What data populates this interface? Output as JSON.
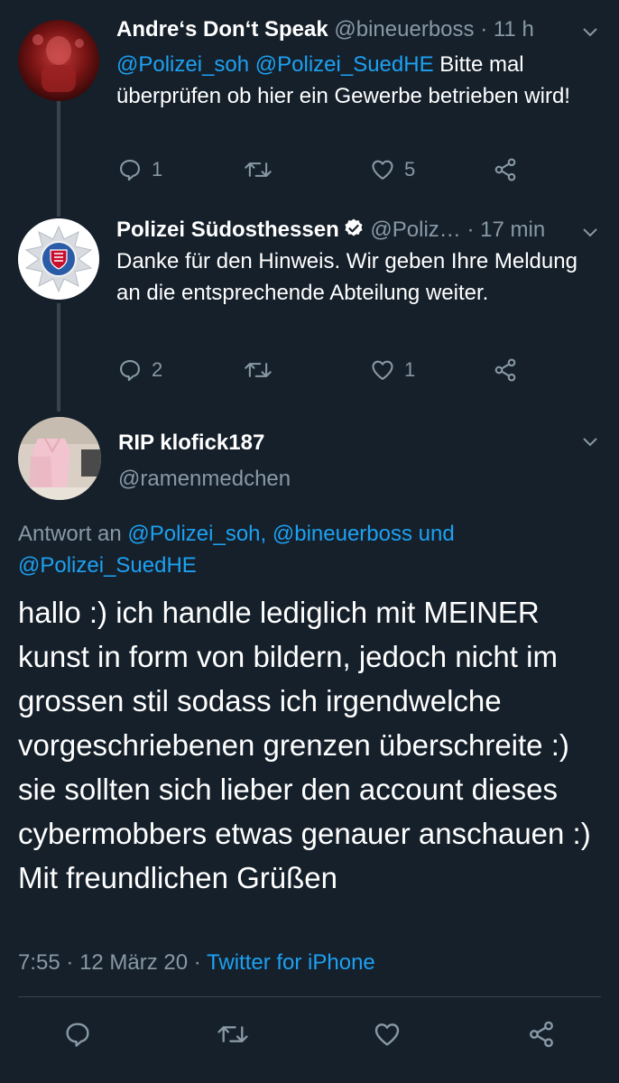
{
  "tweets": [
    {
      "name": "Andre‘s Don‘t Speak",
      "handle": "@bineuerboss",
      "separator": "·",
      "time": "11 h",
      "text_parts": [
        {
          "mention": "@Polizei_soh"
        },
        {
          "text": " "
        },
        {
          "mention": "@Polizei_SuedHE"
        },
        {
          "text": " Bitte mal überprüfen ob hier ein Gewerbe betrieben wird!"
        }
      ],
      "actions": {
        "replies": "1",
        "retweets": "",
        "likes": "5"
      },
      "avatar_icon": "profile-photo-red"
    },
    {
      "name": "Polizei Südosthessen",
      "verified": true,
      "handle": "@Poliz…",
      "separator": "·",
      "time": "17 min",
      "text": "Danke für den Hinweis. Wir geben Ihre Meldung an die entsprechende Abteilung weiter.",
      "actions": {
        "replies": "2",
        "retweets": "",
        "likes": "1"
      },
      "avatar_icon": "police-star-badge"
    }
  ],
  "main_tweet": {
    "name": "RIP klofick187",
    "handle": "@ramenmedchen",
    "reply_prefix": "Antwort an",
    "reply_to": [
      "@Polizei_soh,",
      "@bineuerboss",
      "und",
      "@Polizei_SuedHE"
    ],
    "text": "hallo :) ich handle lediglich mit MEINER kunst in form von bildern, jedoch nicht im grossen stil sodass ich irgendwelche vorgeschriebenen grenzen überschreite :) sie sollten sich lieber den account dieses cybermobbers etwas genauer anschauen :) Mit freundlichen Grüßen",
    "time": "7:55",
    "separator1": "·",
    "date": "12 März 20",
    "separator2": "·",
    "source": "Twitter for iPhone",
    "avatar_icon": "profile-photo-pink-clothes"
  },
  "colors": {
    "background": "#15202b",
    "text": "#ffffff",
    "secondary": "#8899a6",
    "accent": "#1da1f2",
    "divider": "#38444d"
  }
}
